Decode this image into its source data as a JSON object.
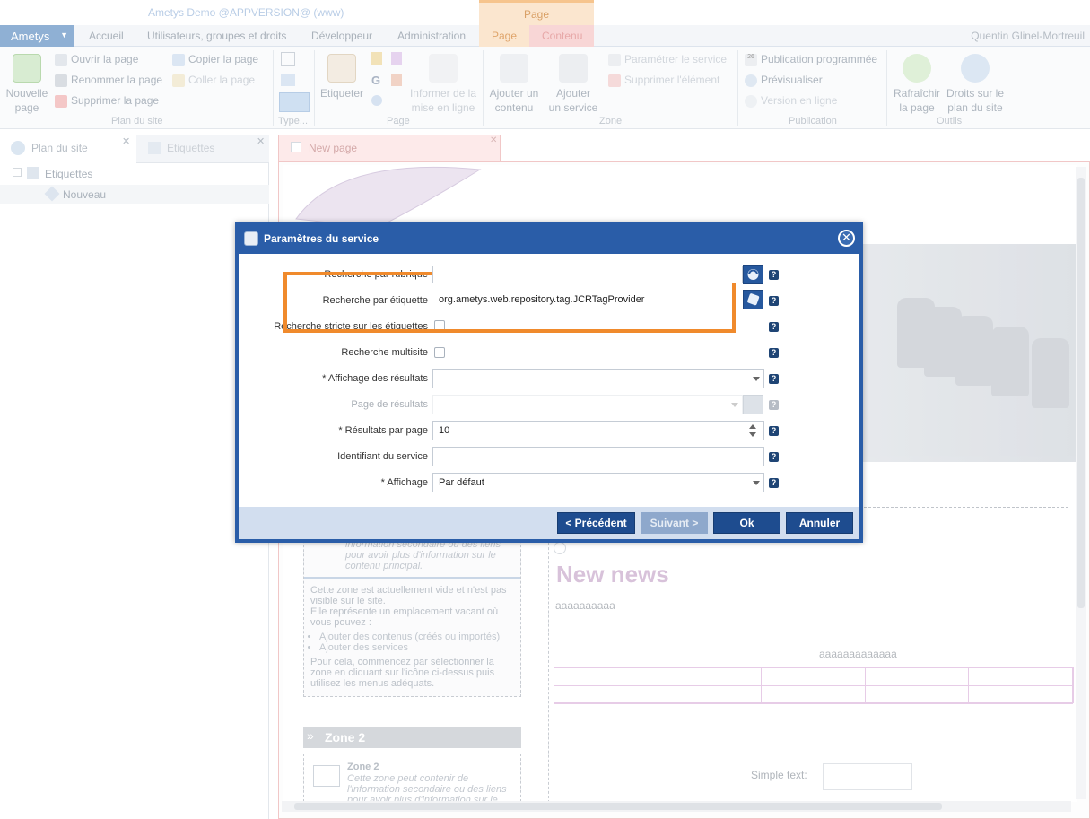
{
  "app": {
    "title": "Ametys Demo @APPVERSION@ (www)",
    "context_group": "Page",
    "user": "Quentin Glinel-Mortreuil"
  },
  "menu": {
    "ametys": "Ametys",
    "tabs": [
      "Accueil",
      "Utilisateurs, groupes et droits",
      "Développeur",
      "Administration"
    ],
    "page_tab": "Page",
    "contenu_tab": "Contenu"
  },
  "ribbon": {
    "nouvelle_page": "Nouvelle\npage",
    "ouvrir": "Ouvrir la page",
    "renommer": "Renommer la page",
    "supprimer": "Supprimer la page",
    "copier": "Copier la page",
    "coller": "Coller la page",
    "plan_du_site_group": "Plan du site",
    "type_group": "Type...",
    "etiqueter": "Etiqueter",
    "informer": "Informer de la\nmise en ligne",
    "page_group": "Page",
    "ajouter_contenu": "Ajouter un\ncontenu",
    "ajouter_service": "Ajouter\nun service",
    "parametrer": "Paramétrer le service",
    "supprimer_element": "Supprimer l'élément",
    "zone_group": "Zone",
    "publication_programmee": "Publication programmée",
    "previsualiser": "Prévisualiser",
    "version_en_ligne": "Version en ligne",
    "publication_group": "Publication",
    "rafraichir": "Rafraîchir\nla page",
    "droits": "Droits sur le\nplan du site",
    "outils_group": "Outils"
  },
  "left_panel": {
    "tab1": "Plan du site",
    "tab2": "Etiquettes",
    "tree_root": "Etiquettes",
    "tree_child": "Nouveau"
  },
  "editor": {
    "tab_label": "New page",
    "zone_text_italic": "information secondaire ou des liens pour avoir plus d'information sur le contenu principal.",
    "zone_empty_1": "Cette zone est actuellement vide et n'est pas visible sur le site.",
    "zone_empty_2": "Elle représente un emplacement vacant où vous pouvez :",
    "zone_bullet_1": "Ajouter des contenus (créés ou importés)",
    "zone_bullet_2": "Ajouter des services",
    "zone_empty_3": "Pour cela, commencez par sélectionner la zone en cliquant sur l'icône ci-dessus puis utilisez les menus adéquats.",
    "zone2_head": "Zone 2",
    "zone2_title": "Zone 2",
    "zone2_text": "Cette zone peut contenir de l'information secondaire ou des liens pour avoir plus d'information sur le",
    "news_title": "New news",
    "news_text1": "aaaaaaaaaa",
    "news_text2": "aaaaaaaaaaaaa",
    "simple_text_label": "Simple text:"
  },
  "dialog": {
    "title": "Paramètres du service",
    "fields": {
      "rubrique_label": "Recherche par rubrique",
      "etiquette_label": "Recherche par étiquette",
      "etiquette_value": "org.ametys.web.repository.tag.JCRTagProvider",
      "stricte_label": "Recherche stricte sur les étiquettes",
      "multisite_label": "Recherche multisite",
      "affichage_resultats_label": "* Affichage des résultats",
      "affichage_resultats_value": "",
      "page_resultats_label": "Page de résultats",
      "resultats_par_page_label": "* Résultats par page",
      "resultats_par_page_value": "10",
      "identifiant_label": "Identifiant du service",
      "identifiant_value": "",
      "affichage_label": "* Affichage",
      "affichage_value": "Par défaut"
    },
    "help": "?",
    "buttons": {
      "precedent": "< Précédent",
      "suivant": "Suivant >",
      "ok": "Ok",
      "annuler": "Annuler"
    }
  }
}
